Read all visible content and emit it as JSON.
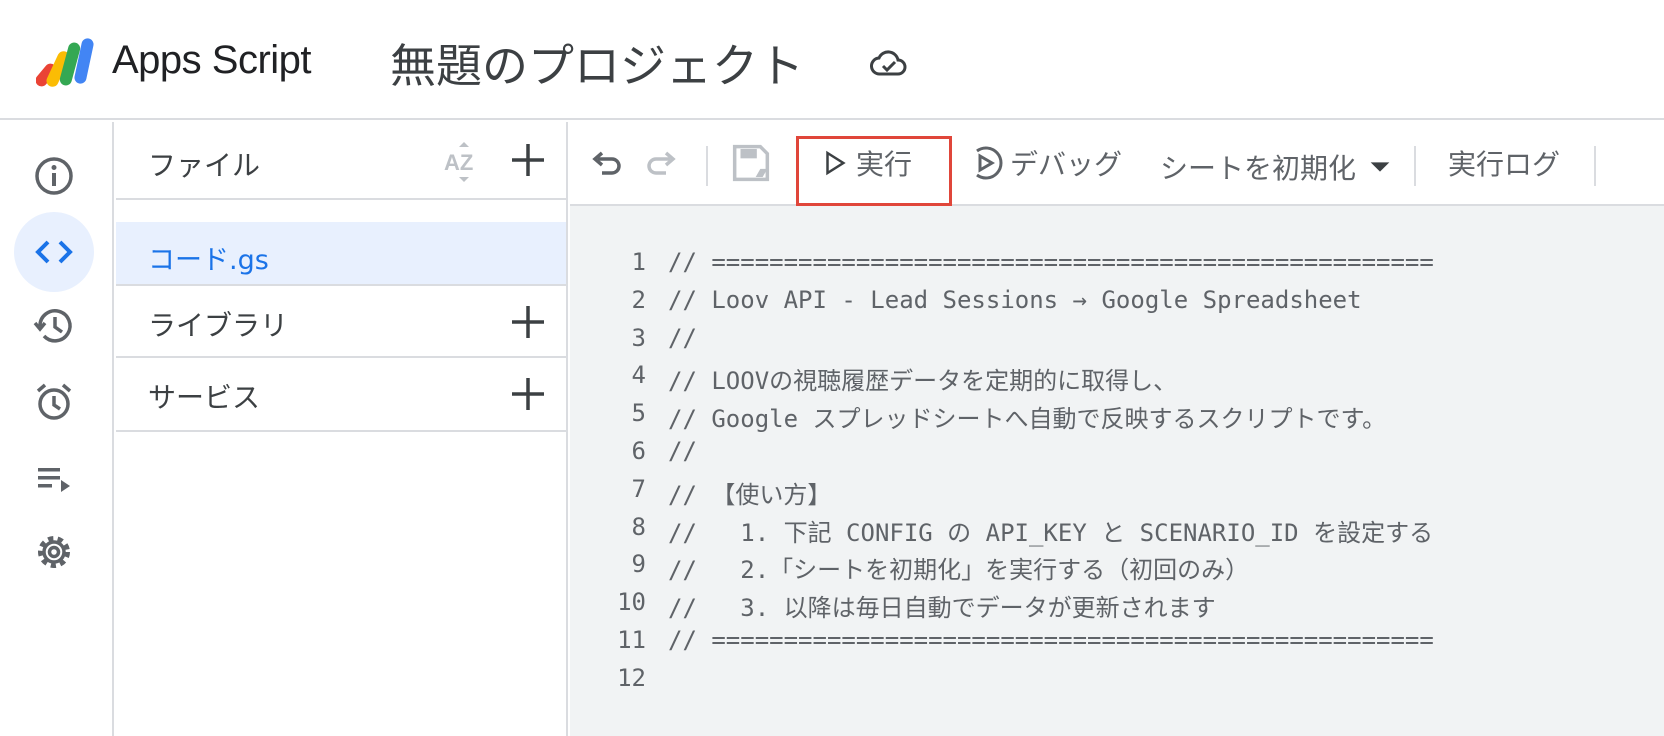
{
  "header": {
    "app_name": "Apps Script",
    "project_title": "無題のプロジェクト",
    "save_status_icon": "cloud-done-icon"
  },
  "rail": {
    "items": [
      {
        "name": "overview",
        "icon": "info-icon"
      },
      {
        "name": "editor",
        "icon": "code-icon",
        "active": true
      },
      {
        "name": "versions",
        "icon": "history-icon"
      },
      {
        "name": "triggers",
        "icon": "alarm-icon"
      },
      {
        "name": "executions",
        "icon": "playlist-play-icon"
      },
      {
        "name": "settings",
        "icon": "gear-icon"
      }
    ]
  },
  "files_panel": {
    "files_label": "ファイル",
    "sort_icon": "sort-az-icon",
    "files": [
      {
        "name": "コード.gs",
        "selected": true
      }
    ],
    "libraries_label": "ライブラリ",
    "services_label": "サービス"
  },
  "toolbar": {
    "undo_icon": "undo-icon",
    "redo_icon": "redo-icon",
    "save_icon": "save-drive-icon",
    "run_label": "実行",
    "debug_label": "デバッグ",
    "function_select": "シートを初期化",
    "log_label": "実行ログ"
  },
  "editor": {
    "lines": [
      {
        "n": "1",
        "text": "// =================================================="
      },
      {
        "n": "2",
        "text": "// Loov API - Lead Sessions → Google Spreadsheet"
      },
      {
        "n": "3",
        "text": "//"
      },
      {
        "n": "4",
        "text": "// LOOVの視聴履歴データを定期的に取得し、"
      },
      {
        "n": "5",
        "text": "// Google スプレッドシートへ自動で反映するスクリプトです。"
      },
      {
        "n": "6",
        "text": "//"
      },
      {
        "n": "7",
        "text": "// 【使い方】"
      },
      {
        "n": "8",
        "text": "//   1. 下記 CONFIG の API_KEY と SCENARIO_ID を設定する"
      },
      {
        "n": "9",
        "text": "//   2.「シートを初期化」を実行する（初回のみ）"
      },
      {
        "n": "10",
        "text": "//   3. 以降は毎日自動でデータが更新されます"
      },
      {
        "n": "11",
        "text": "// =================================================="
      },
      {
        "n": "12",
        "text": ""
      }
    ]
  },
  "colors": {
    "accent": "#1a73e8",
    "highlight": "#e0463a",
    "editor_bg": "#f1f3f4",
    "selected_bg": "#e8f0fe"
  }
}
